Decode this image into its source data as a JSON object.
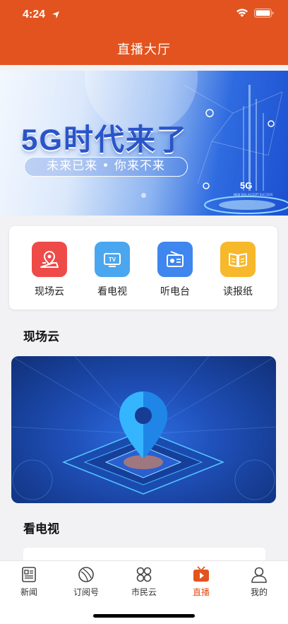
{
  "status_bar": {
    "time": "4:24"
  },
  "header": {
    "title": "直播大厅"
  },
  "banner": {
    "headline": "5G时代来了",
    "subtitle": "未来已来 • 你来不来",
    "badge": "5G",
    "badge_small": "NEW ERA ACCEPT SUCCESS"
  },
  "grid": [
    {
      "label": "现场云",
      "icon": "location-pin-icon",
      "color": "#ee4b48"
    },
    {
      "label": "看电视",
      "icon": "tv-icon",
      "color": "#4aa6ee"
    },
    {
      "label": "听电台",
      "icon": "radio-icon",
      "color": "#3f86ee"
    },
    {
      "label": "读报纸",
      "icon": "newspaper-icon",
      "color": "#f7b82b"
    }
  ],
  "sections": {
    "live_cloud": "现场云",
    "watch_tv": "看电视"
  },
  "tabs": [
    {
      "label": "新闻",
      "icon": "news-icon"
    },
    {
      "label": "订阅号",
      "icon": "subscribe-icon"
    },
    {
      "label": "市民云",
      "icon": "citizen-cloud-icon"
    },
    {
      "label": "直播",
      "icon": "live-tv-icon",
      "active": true
    },
    {
      "label": "我的",
      "icon": "profile-icon"
    }
  ],
  "colors": {
    "brand": "#e2531f",
    "background": "#f2f2f4"
  }
}
